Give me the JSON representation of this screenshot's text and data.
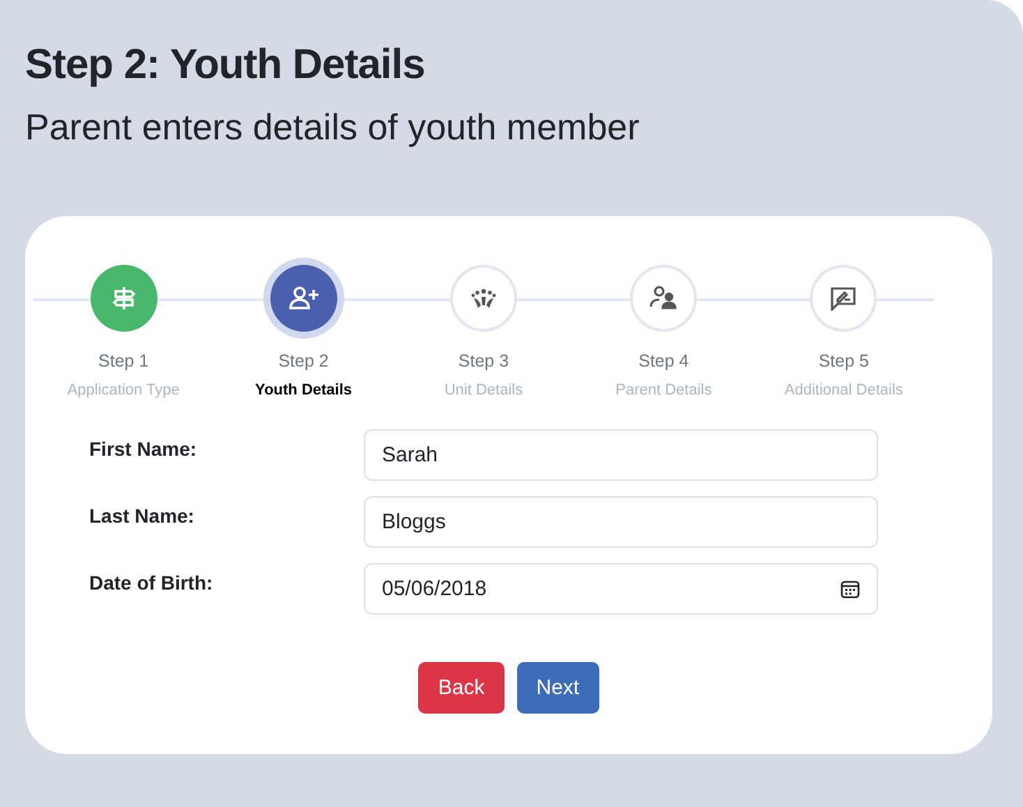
{
  "header": {
    "title": "Step 2: Youth Details",
    "subtitle": "Parent enters details of youth member"
  },
  "steps": [
    {
      "label": "Step 1",
      "caption": "Application Type",
      "completed": true,
      "selected": false
    },
    {
      "label": "Step 2",
      "caption": "Youth Details",
      "completed": false,
      "selected": true
    },
    {
      "label": "Step 3",
      "caption": "Unit Details",
      "completed": false,
      "selected": false
    },
    {
      "label": "Step 4",
      "caption": "Parent Details",
      "completed": false,
      "selected": false
    },
    {
      "label": "Step 5",
      "caption": "Additional Details",
      "completed": false,
      "selected": false
    }
  ],
  "fields": [
    {
      "label": "First Name:",
      "value": "Sarah",
      "kind": "text"
    },
    {
      "label": "Last Name:",
      "value": "Bloggs",
      "kind": "text"
    },
    {
      "label": "Date of Birth:",
      "value": "05/06/2018",
      "kind": "date"
    }
  ],
  "buttons": [
    {
      "label": "Back",
      "kind": "back"
    },
    {
      "label": "Next",
      "kind": "next"
    }
  ]
}
